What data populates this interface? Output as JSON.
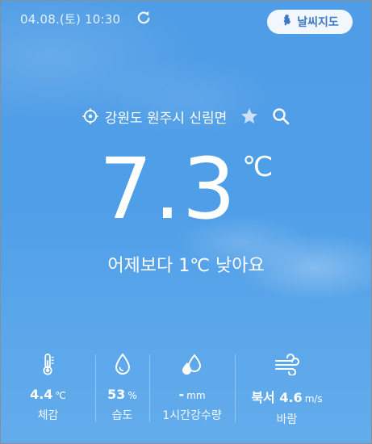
{
  "header": {
    "datetime": "04.08.(토) 10:30",
    "map_button_label": "날씨지도"
  },
  "location": {
    "name": "강원도 원주시 신림면"
  },
  "current": {
    "temperature": "7.3",
    "unit": "℃",
    "comparison": "어제보다 1℃ 낮아요"
  },
  "stats": [
    {
      "icon": "thermometer-icon",
      "value": "4.4",
      "unit": "℃",
      "label": "체감"
    },
    {
      "icon": "water-drop-icon",
      "value": "53",
      "unit": "%",
      "label": "습도"
    },
    {
      "icon": "rain-drops-icon",
      "value": "-",
      "unit": "mm",
      "label": "1시간강수량"
    },
    {
      "icon": "wind-icon",
      "value": "북서 4.6",
      "unit": "m/s",
      "label": "바람"
    }
  ],
  "colors": {
    "sky_top": "#4f9de6",
    "sky_bottom": "#63acec",
    "accent_blue": "#3b78c6",
    "text": "#ffffff"
  }
}
